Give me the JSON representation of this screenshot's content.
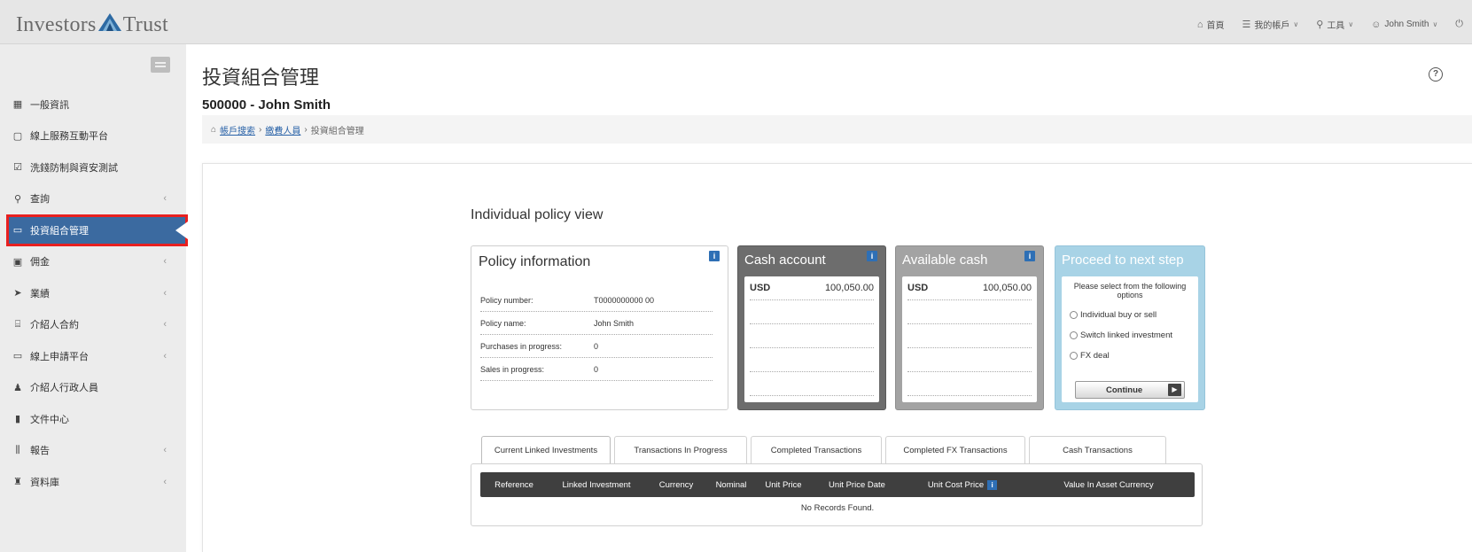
{
  "header": {
    "logo_left": "Investors",
    "logo_right": "Trust",
    "nav": [
      {
        "icon": "home-icon",
        "label": "首頁"
      },
      {
        "icon": "list-icon",
        "label": "我的帳戶"
      },
      {
        "icon": "wrench-icon",
        "label": "工具"
      },
      {
        "icon": "user-icon",
        "label": "John Smith"
      }
    ]
  },
  "sidebar": {
    "items": [
      {
        "label": "一般資訊",
        "icon": "grid-icon"
      },
      {
        "label": "線上服務互動平台",
        "icon": "monitor-icon"
      },
      {
        "label": "洗錢防制與資安測試",
        "icon": "checklist-icon"
      },
      {
        "label": "查詢",
        "icon": "search-icon"
      },
      {
        "label": "投資組合管理",
        "icon": "portfolio-icon"
      },
      {
        "label": "佣金",
        "icon": "money-icon"
      },
      {
        "label": "業績",
        "icon": "send-icon"
      },
      {
        "label": "介紹人合約",
        "icon": "contract-icon"
      },
      {
        "label": "線上申請平台",
        "icon": "laptop-icon"
      },
      {
        "label": "介紹人行政人員",
        "icon": "users-icon"
      },
      {
        "label": "文件中心",
        "icon": "document-icon"
      },
      {
        "label": "報告",
        "icon": "chart-icon"
      },
      {
        "label": "資料庫",
        "icon": "book-icon"
      }
    ]
  },
  "page": {
    "title": "投資組合管理",
    "subtitle": "500000 - John Smith",
    "breadcrumb": [
      "帳戶搜索",
      "繳費人員",
      "投資組合管理"
    ]
  },
  "main": {
    "section_title": "Individual policy view",
    "policy_info": {
      "title": "Policy information",
      "rows": [
        {
          "label": "Policy number:",
          "value": "T0000000000 00"
        },
        {
          "label": "Policy name:",
          "value": "John Smith"
        },
        {
          "label": "Purchases in progress:",
          "value": "0"
        },
        {
          "label": "Sales in progress:",
          "value": "0"
        }
      ]
    },
    "cash_account": {
      "title": "Cash account",
      "currency": "USD",
      "amount": "100,050.00"
    },
    "available_cash": {
      "title": "Available cash",
      "currency": "USD",
      "amount": "100,050.00"
    },
    "proceed": {
      "title": "Proceed to next step",
      "hint": "Please select from the following options",
      "options": [
        "Individual buy or sell",
        "Switch linked investment",
        "FX deal"
      ],
      "continue_label": "Continue"
    },
    "tabs": [
      "Current Linked Investments",
      "Transactions In Progress",
      "Completed Transactions",
      "Completed FX Transactions",
      "Cash Transactions"
    ],
    "table_headers": [
      "Reference",
      "Linked Investment",
      "Currency",
      "Nominal",
      "Unit Price",
      "Unit Price Date",
      "Unit Cost Price",
      "Value In Asset Currency"
    ],
    "no_records": "No Records Found."
  },
  "colors": {
    "active_nav": "#3b6aa0",
    "highlight": "#e8201f",
    "cash_card": "#6d6d6d",
    "available_card": "#a3a3a3",
    "proceed_card": "#a8d3e6",
    "info_badge": "#2e6fb5"
  }
}
